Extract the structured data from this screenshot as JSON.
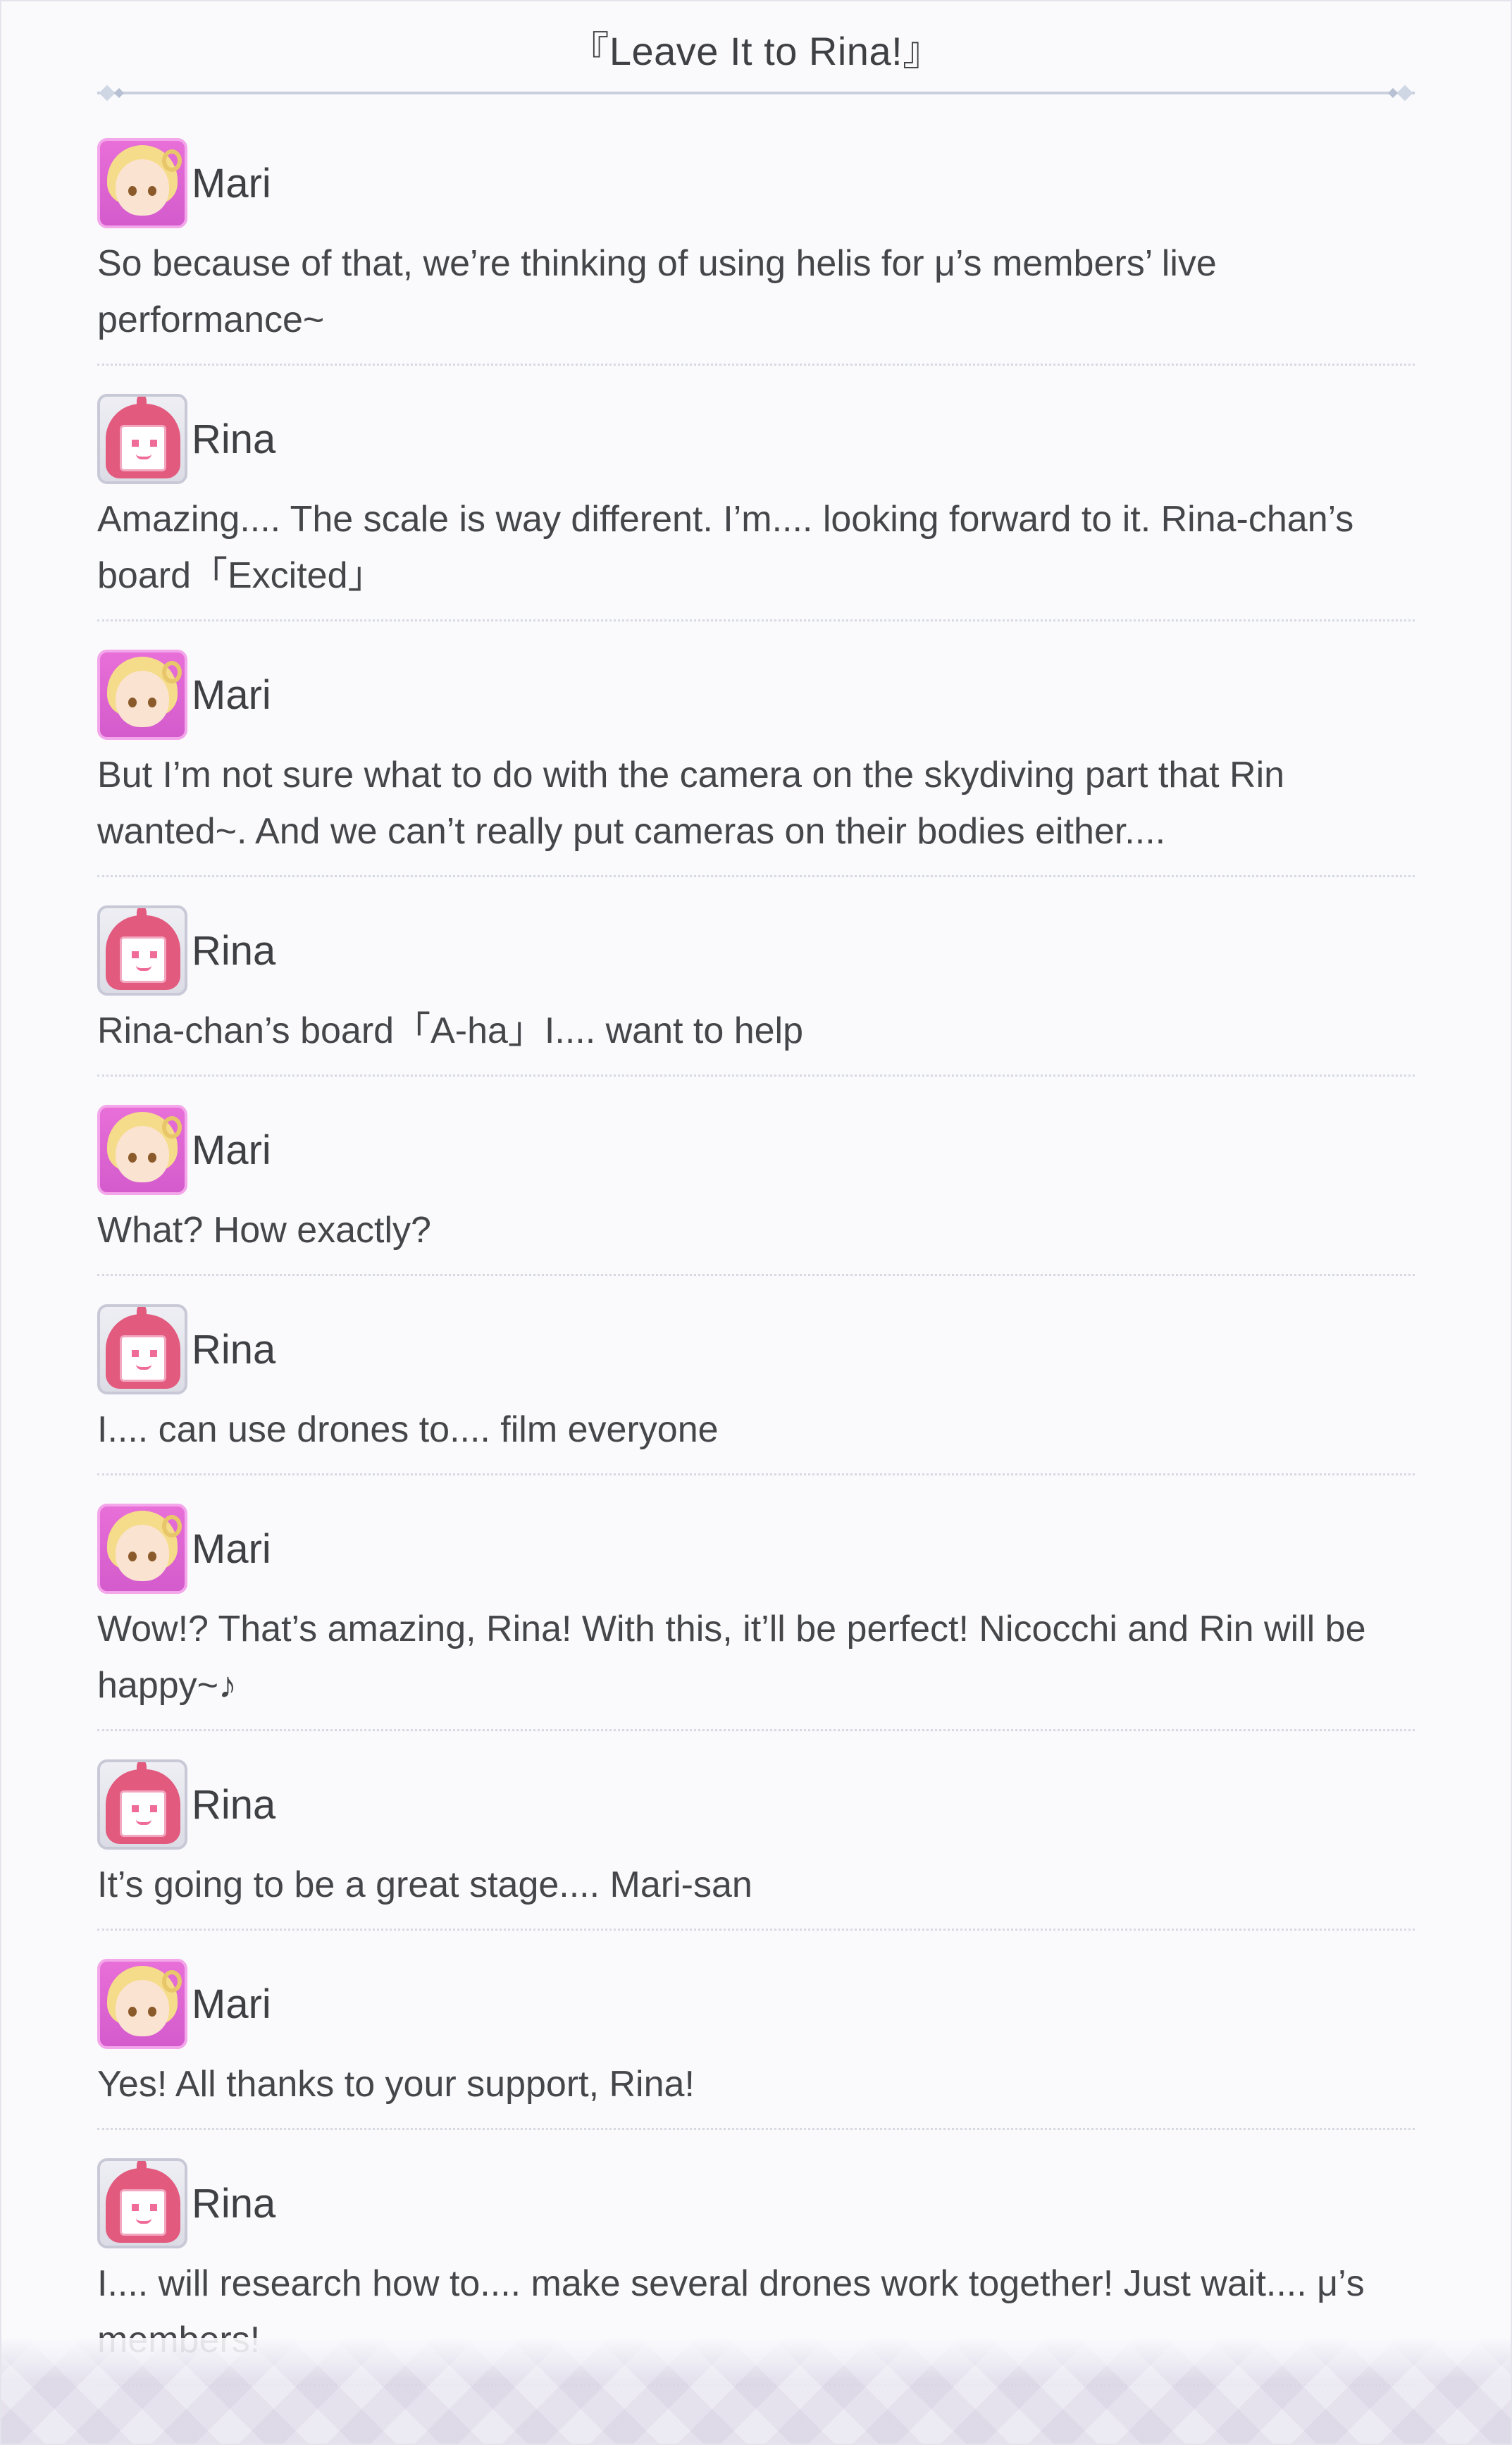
{
  "title": "『Leave It to Rina!』",
  "entries": [
    {
      "speaker": "Mari",
      "text": "So because of that, we’re thinking of using helis for μ’s members’ live performance~"
    },
    {
      "speaker": "Rina",
      "text": "Amazing.... The scale is way different. I’m.... looking forward to it. Rina-chan’s board「Excited」"
    },
    {
      "speaker": "Mari",
      "text": "But I’m not sure what to do with the camera on the skydiving part that Rin wanted~. And we can’t really put cameras on their bodies either...."
    },
    {
      "speaker": "Rina",
      "text": "Rina-chan’s board「A-ha」I.... want to help"
    },
    {
      "speaker": "Mari",
      "text": "What? How exactly?"
    },
    {
      "speaker": "Rina",
      "text": "I.... can use drones to.... film everyone"
    },
    {
      "speaker": "Mari",
      "text": "Wow!? That’s amazing, Rina! With this, it’ll be perfect! Nicocchi and Rin will be happy~♪"
    },
    {
      "speaker": "Rina",
      "text": "It’s going to be a great stage.... Mari-san"
    },
    {
      "speaker": "Mari",
      "text": "Yes! All thanks to your support, Rina!"
    },
    {
      "speaker": "Rina",
      "text": "I.... will research how to.... make several drones work together! Just wait.... μ’s members!"
    }
  ]
}
